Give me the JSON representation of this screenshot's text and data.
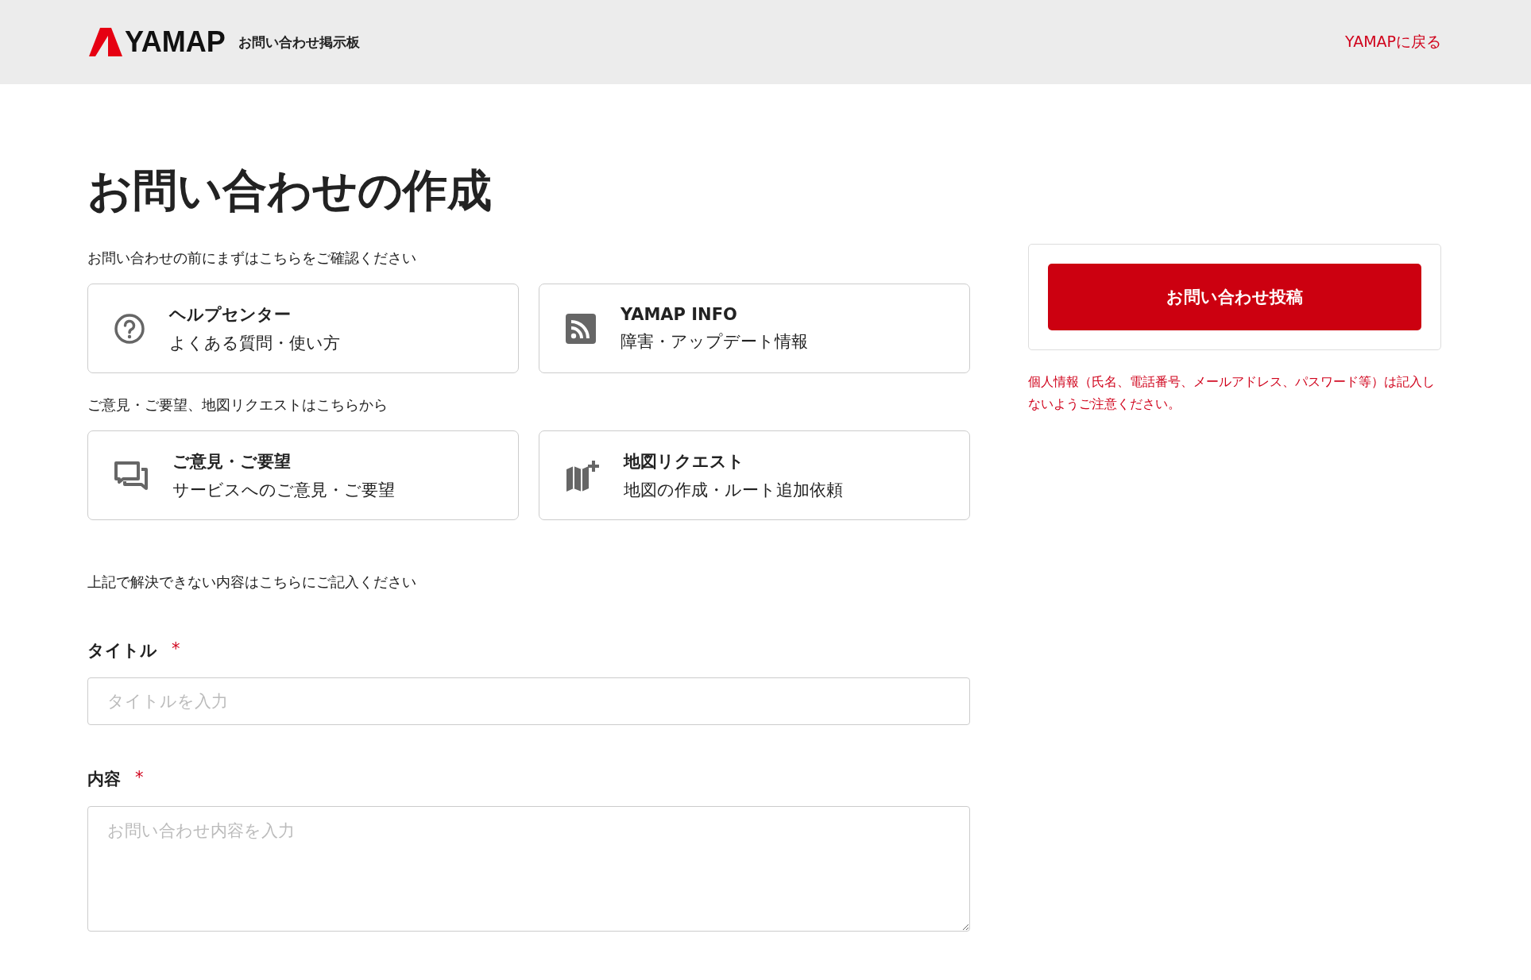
{
  "header": {
    "logo": "YAMAP",
    "site_title": "お問い合わせ掲示板",
    "back_link": "YAMAPに戻る"
  },
  "page_title": "お問い合わせの作成",
  "sections": [
    {
      "intro": "お問い合わせの前にまずはこちらをご確認ください",
      "cards": [
        {
          "kind": "help",
          "title": "ヘルプセンター",
          "subtitle": "よくある質問・使い方"
        },
        {
          "kind": "feed",
          "title": "YAMAP INFO",
          "subtitle": "障害・アップデート情報"
        }
      ]
    },
    {
      "intro": "ご意見・ご要望、地図リクエストはこちらから",
      "cards": [
        {
          "kind": "chat",
          "title": "ご意見・ご要望",
          "subtitle": "サービスへのご意見・ご要望"
        },
        {
          "kind": "map",
          "title": "地図リクエスト",
          "subtitle": "地図の作成・ルート追加依頼"
        }
      ]
    }
  ],
  "form_intro": "上記で解決できない内容はこちらにご記入ください",
  "fields": [
    {
      "kind": "input",
      "label": "タイトル",
      "required_mark": "*",
      "placeholder": "タイトルを入力"
    },
    {
      "kind": "textarea",
      "label": "内容",
      "required_mark": "*",
      "placeholder": "お問い合わせ内容を入力"
    }
  ],
  "submit_button": "お問い合わせ投稿",
  "notice": "個人情報（氏名、電話番号、メールアドレス、パスワード等）は記入しないようご注意ください。"
}
